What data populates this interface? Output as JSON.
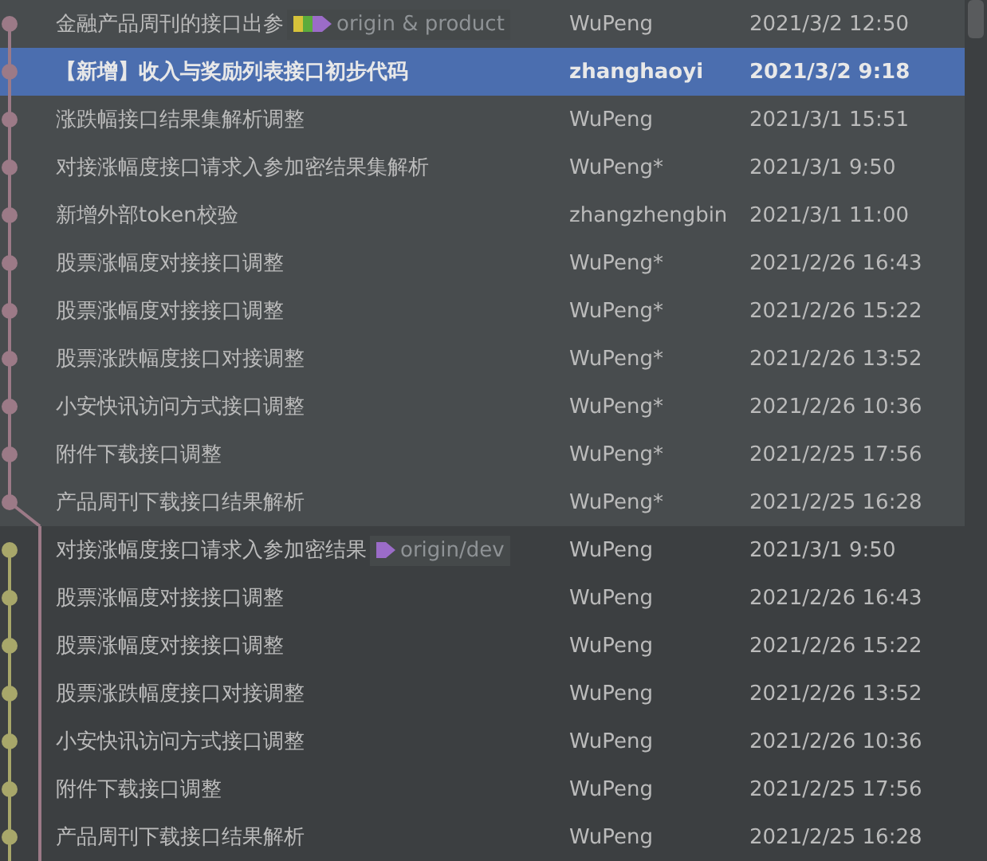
{
  "commits": [
    {
      "kind": "main",
      "color": "#9c7a87",
      "subject": "金融产品周刊的接口出参",
      "tag": {
        "label": "origin & product",
        "kind": "multiple"
      },
      "author": "WuPeng",
      "date": "2021/3/2 12:50",
      "selected": false,
      "highlighted": true
    },
    {
      "kind": "main",
      "color": "#9c7a87",
      "subject": "【新增】收入与奖励列表接口初步代码",
      "author": "zhanghaoyi",
      "date": "2021/3/2 9:18",
      "selected": true,
      "highlighted": true
    },
    {
      "kind": "main",
      "color": "#9c7a87",
      "subject": "涨跌幅接口结果集解析调整",
      "author": "WuPeng",
      "date": "2021/3/1 15:51",
      "selected": false,
      "highlighted": true
    },
    {
      "kind": "main",
      "color": "#9c7a87",
      "subject": "对接涨幅度接口请求入参加密结果集解析",
      "author": "WuPeng*",
      "date": "2021/3/1 9:50",
      "selected": false,
      "highlighted": true
    },
    {
      "kind": "main",
      "color": "#9c7a87",
      "subject": "新增外部token校验",
      "author": "zhangzhengbin",
      "date": "2021/3/1 11:00",
      "selected": false,
      "highlighted": true
    },
    {
      "kind": "main",
      "color": "#9c7a87",
      "subject": "股票涨幅度对接接口调整",
      "author": "WuPeng*",
      "date": "2021/2/26 16:43",
      "selected": false,
      "highlighted": true
    },
    {
      "kind": "main",
      "color": "#9c7a87",
      "subject": "股票涨幅度对接接口调整",
      "author": "WuPeng*",
      "date": "2021/2/26 15:22",
      "selected": false,
      "highlighted": true
    },
    {
      "kind": "main",
      "color": "#9c7a87",
      "subject": "股票涨跌幅度接口对接调整",
      "author": "WuPeng*",
      "date": "2021/2/26 13:52",
      "selected": false,
      "highlighted": true
    },
    {
      "kind": "main",
      "color": "#9c7a87",
      "subject": "小安快讯访问方式接口调整",
      "author": "WuPeng*",
      "date": "2021/2/26 10:36",
      "selected": false,
      "highlighted": true
    },
    {
      "kind": "main",
      "color": "#9c7a87",
      "subject": "附件下载接口调整",
      "author": "WuPeng*",
      "date": "2021/2/25 17:56",
      "selected": false,
      "highlighted": true
    },
    {
      "kind": "fork",
      "color": "#9c7a87",
      "subject": "产品周刊下载接口结果解析",
      "author": "WuPeng*",
      "date": "2021/2/25 16:28",
      "selected": false,
      "highlighted": true
    },
    {
      "kind": "side",
      "color": "#a8a76a",
      "subject": "对接涨幅度接口请求入参加密结果",
      "tag": {
        "label": "origin/dev",
        "kind": "single"
      },
      "author": "WuPeng",
      "date": "2021/3/1 9:50",
      "selected": false,
      "highlighted": false
    },
    {
      "kind": "side",
      "color": "#a8a76a",
      "subject": "股票涨幅度对接接口调整",
      "author": "WuPeng",
      "date": "2021/2/26 16:43",
      "selected": false,
      "highlighted": false
    },
    {
      "kind": "side",
      "color": "#a8a76a",
      "subject": "股票涨幅度对接接口调整",
      "author": "WuPeng",
      "date": "2021/2/26 15:22",
      "selected": false,
      "highlighted": false
    },
    {
      "kind": "side",
      "color": "#a8a76a",
      "subject": "股票涨跌幅度接口对接调整",
      "author": "WuPeng",
      "date": "2021/2/26 13:52",
      "selected": false,
      "highlighted": false
    },
    {
      "kind": "side",
      "color": "#a8a76a",
      "subject": "小安快讯访问方式接口调整",
      "author": "WuPeng",
      "date": "2021/2/26 10:36",
      "selected": false,
      "highlighted": false
    },
    {
      "kind": "side",
      "color": "#a8a76a",
      "subject": "附件下载接口调整",
      "author": "WuPeng",
      "date": "2021/2/25 17:56",
      "selected": false,
      "highlighted": false
    },
    {
      "kind": "side",
      "color": "#a8a76a",
      "subject": "产品周刊下载接口结果解析",
      "author": "WuPeng",
      "date": "2021/2/25 16:28",
      "selected": false,
      "highlighted": false
    }
  ]
}
